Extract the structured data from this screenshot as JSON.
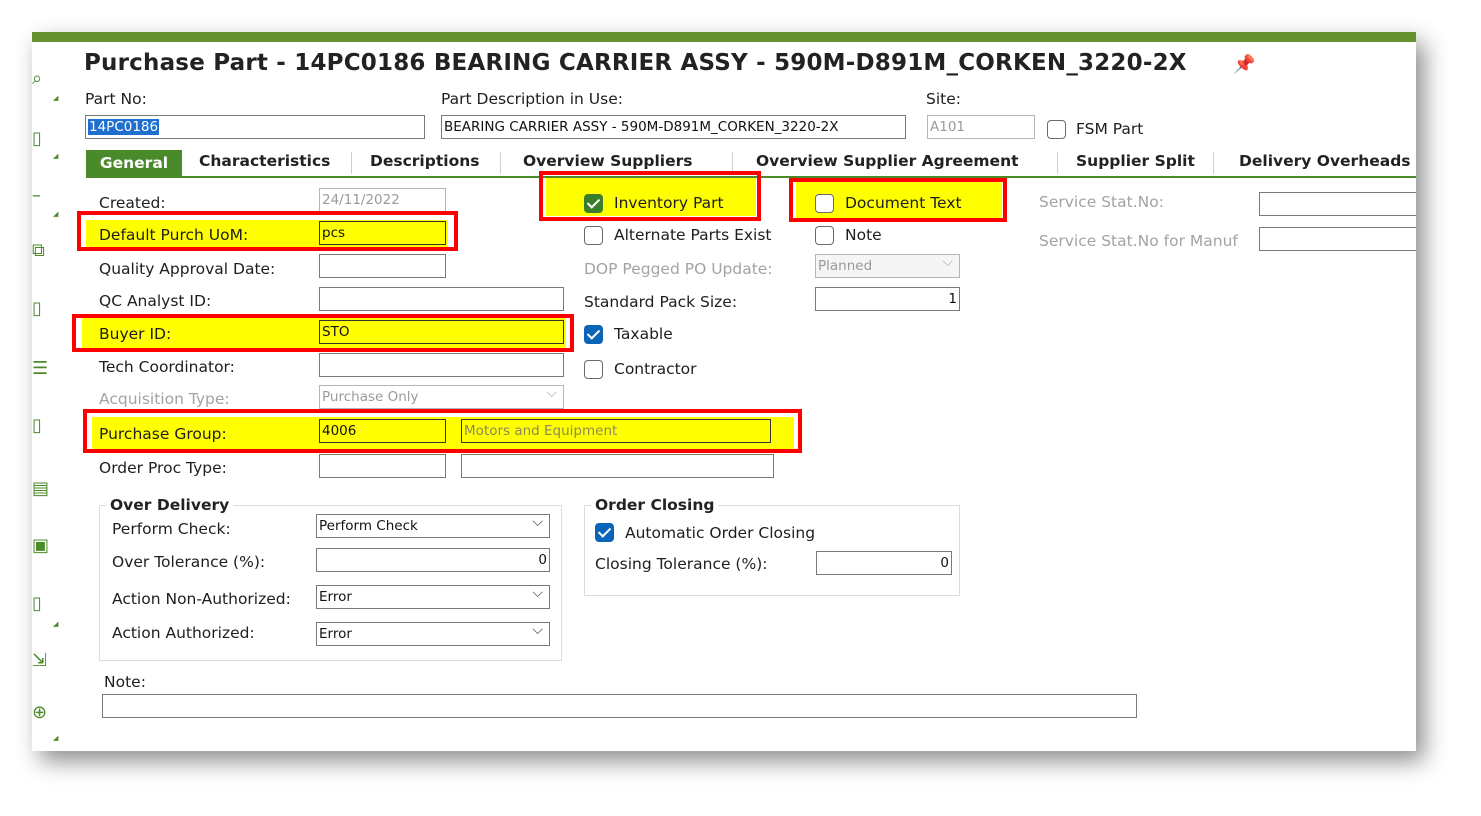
{
  "title": "Purchase Part - 14PC0186 BEARING CARRIER ASSY - 590M-D891M_CORKEN_3220-2X",
  "header": {
    "part_no_label": "Part No:",
    "part_no_value": "14PC0186",
    "part_desc_label": "Part Description in Use:",
    "part_desc_value": "BEARING CARRIER ASSY - 590M-D891M_CORKEN_3220-2X",
    "site_label": "Site:",
    "site_value": "A101",
    "fsm_label": "FSM Part"
  },
  "tabs": [
    {
      "label": "General"
    },
    {
      "label": "Characteristics"
    },
    {
      "label": "Descriptions"
    },
    {
      "label": "Overview Suppliers"
    },
    {
      "label": "Overview Supplier Agreement"
    },
    {
      "label": "Supplier Split"
    },
    {
      "label": "Delivery Overheads"
    }
  ],
  "form": {
    "created_label": "Created:",
    "created_value": "24/11/2022",
    "uom_label": "Default Purch UoM:",
    "uom_value": "pcs",
    "qad_label": "Quality Approval Date:",
    "qad_value": "",
    "qc_label": "QC Analyst ID:",
    "qc_value": "",
    "buyer_label": "Buyer ID:",
    "buyer_value": "STO",
    "tech_label": "Tech Coordinator:",
    "tech_value": "",
    "acq_label": "Acquisition Type:",
    "acq_value": "Purchase Only",
    "pg_label": "Purchase Group:",
    "pg_value": "4006",
    "pg_desc": "Motors and Equipment",
    "opt_label": "Order Proc Type:",
    "opt_value": "",
    "opt_desc": ""
  },
  "middle": {
    "inventory_part_label": "Inventory Part",
    "alternate_label": "Alternate Parts Exist",
    "dop_label": "DOP Pegged PO Update:",
    "dop_value": "Planned",
    "pack_label": "Standard Pack Size:",
    "pack_value": "1",
    "taxable_label": "Taxable",
    "contractor_label": "Contractor",
    "doc_text_label": "Document Text",
    "note_cb_label": "Note"
  },
  "right": {
    "service_label": "Service Stat.No:",
    "service_value": "",
    "service_manuf_label": "Service Stat.No for Manuf",
    "service_manuf_value": ""
  },
  "over_delivery": {
    "title": "Over Delivery",
    "perform_label": "Perform Check:",
    "perform_value": "Perform Check",
    "tol_label": "Over Tolerance (%):",
    "tol_value": "0",
    "nonauth_label": "Action Non-Authorized:",
    "nonauth_value": "Error",
    "auth_label": "Action Authorized:",
    "auth_value": "Error"
  },
  "order_closing": {
    "title": "Order Closing",
    "auto_label": "Automatic Order Closing",
    "tol_label": "Closing Tolerance (%):",
    "tol_value": "0"
  },
  "note": {
    "label": "Note:",
    "value": ""
  },
  "colors": {
    "accent": "#64912d",
    "tab_active": "#4b8a2b",
    "highlight": "#ffff00",
    "annotation": "#ff0000",
    "checkbox_blue": "#0a65b8"
  }
}
